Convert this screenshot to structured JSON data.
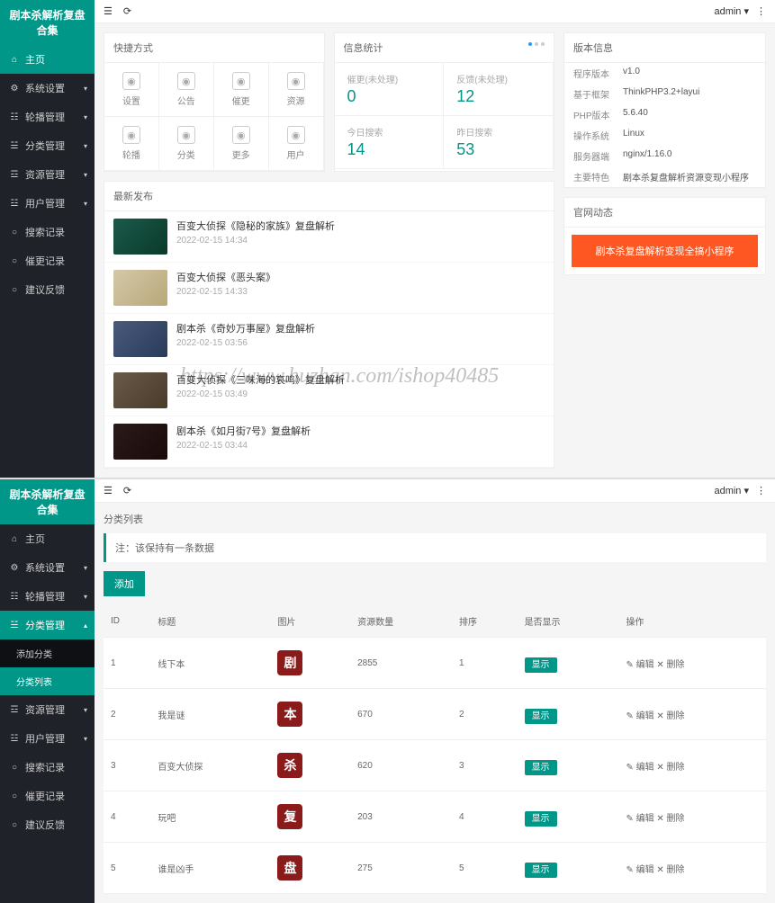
{
  "app_title": "剧本杀解析复盘合集",
  "topbar": {
    "user": "admin",
    "menu_icon": "☰",
    "refresh_icon": "⟳",
    "more_icon": "⋮"
  },
  "nav1": [
    {
      "icon": "⌂",
      "label": "主页",
      "active": true
    },
    {
      "icon": "⚙",
      "label": "系统设置",
      "arrow": "▾"
    },
    {
      "icon": "☷",
      "label": "轮播管理",
      "arrow": "▾"
    },
    {
      "icon": "☱",
      "label": "分类管理",
      "arrow": "▾"
    },
    {
      "icon": "☲",
      "label": "资源管理",
      "arrow": "▾"
    },
    {
      "icon": "☳",
      "label": "用户管理",
      "arrow": "▾"
    },
    {
      "icon": "○",
      "label": "搜索记录"
    },
    {
      "icon": "○",
      "label": "催更记录"
    },
    {
      "icon": "○",
      "label": "建议反馈"
    }
  ],
  "nav2": [
    {
      "icon": "⌂",
      "label": "主页"
    },
    {
      "icon": "⚙",
      "label": "系统设置",
      "arrow": "▾"
    },
    {
      "icon": "☷",
      "label": "轮播管理",
      "arrow": "▾"
    },
    {
      "icon": "☱",
      "label": "分类管理",
      "arrow": "▴",
      "active": true
    },
    {
      "label": "添加分类",
      "sub": true
    },
    {
      "label": "分类列表",
      "sub": true,
      "active": true
    },
    {
      "icon": "☲",
      "label": "资源管理",
      "arrow": "▾"
    },
    {
      "icon": "☳",
      "label": "用户管理",
      "arrow": "▾"
    },
    {
      "icon": "○",
      "label": "搜索记录"
    },
    {
      "icon": "○",
      "label": "催更记录"
    },
    {
      "icon": "○",
      "label": "建议反馈"
    }
  ],
  "quick": {
    "title": "快捷方式",
    "items": [
      {
        "label": "设置"
      },
      {
        "label": "公告"
      },
      {
        "label": "催更"
      },
      {
        "label": "资源"
      },
      {
        "label": "轮播"
      },
      {
        "label": "分类"
      },
      {
        "label": "更多"
      },
      {
        "label": "用户"
      }
    ]
  },
  "stats": {
    "title": "信息统计",
    "cells": [
      {
        "label": "催更(未处理)",
        "value": "0"
      },
      {
        "label": "反馈(未处理)",
        "value": "12"
      },
      {
        "label": "今日搜索",
        "value": "14"
      },
      {
        "label": "昨日搜索",
        "value": "53"
      }
    ]
  },
  "version": {
    "title": "版本信息",
    "rows": [
      {
        "k": "程序版本",
        "v": "v1.0"
      },
      {
        "k": "基于框架",
        "v": "ThinkPHP3.2+layui"
      },
      {
        "k": "PHP版本",
        "v": "5.6.40"
      },
      {
        "k": "操作系统",
        "v": "Linux"
      },
      {
        "k": "服务器端",
        "v": "nginx/1.16.0"
      },
      {
        "k": "主要特色",
        "v": "剧本杀复盘解析资源变现小程序"
      }
    ]
  },
  "official": {
    "title": "官网动态",
    "button": "剧本杀复盘解析变现全搞小程序"
  },
  "news": {
    "title": "最新发布",
    "items": [
      {
        "title": "百变大侦探《隐秘的家族》复盘解析",
        "time": "2022-02-15 14:34"
      },
      {
        "title": "百变大侦探《恶头案》",
        "time": "2022-02-15 14:33"
      },
      {
        "title": "剧本杀《奇妙万事屋》复盘解析",
        "time": "2022-02-15 03:56"
      },
      {
        "title": "百变大侦探《三味海的哀鸣》复盘解析",
        "time": "2022-02-15 03:49"
      },
      {
        "title": "剧本杀《如月街7号》复盘解析",
        "time": "2022-02-15 03:44"
      }
    ]
  },
  "watermark": "https://www.huzhan.com/ishop40485",
  "list_page": {
    "title": "分类列表",
    "notice": "注：该保持有一条数据",
    "add_btn": "添加",
    "headers": [
      "ID",
      "标题",
      "图片",
      "资源数量",
      "排序",
      "是否显示",
      "操作"
    ],
    "badge_text": "显示",
    "action_edit": "✎ 编辑",
    "action_delete": "✕ 删除",
    "rows": [
      {
        "id": "1",
        "title": "线下本",
        "icon": "剧",
        "count": "2855",
        "sort": "1"
      },
      {
        "id": "2",
        "title": "我是谜",
        "icon": "本",
        "count": "670",
        "sort": "2"
      },
      {
        "id": "3",
        "title": "百变大侦探",
        "icon": "杀",
        "count": "620",
        "sort": "3"
      },
      {
        "id": "4",
        "title": "玩吧",
        "icon": "复",
        "count": "203",
        "sort": "4"
      },
      {
        "id": "5",
        "title": "谁是凶手",
        "icon": "盘",
        "count": "275",
        "sort": "5"
      }
    ]
  }
}
